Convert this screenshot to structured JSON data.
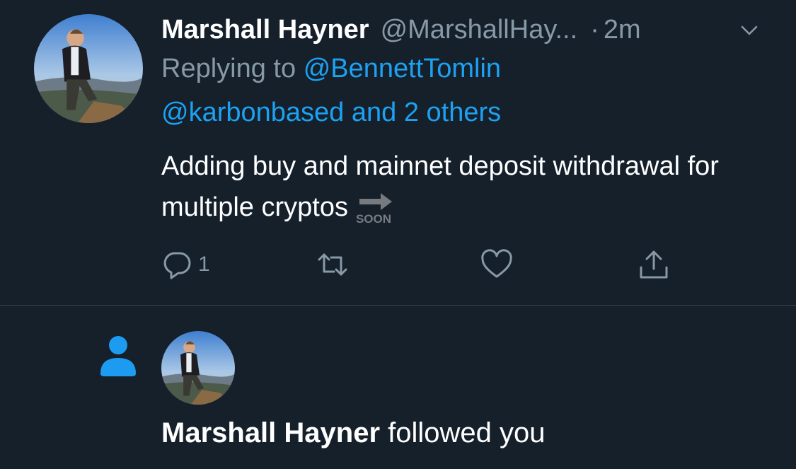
{
  "tweet": {
    "author_name": "Marshall Hayner",
    "author_handle": "@MarshallHay...",
    "separator": "·",
    "time": "2m",
    "replying_prefix": "Replying to",
    "replying_user": "@BennettTomlin",
    "replying_user_2": "@karbonbased",
    "replying_and_others": "and 2 others",
    "text": "Adding buy and mainnet deposit withdrawal for multiple cryptos",
    "emoji_text": "SOON",
    "reply_count": "1"
  },
  "notification": {
    "actor_name": "Marshall Hayner",
    "action_text": "followed you"
  },
  "colors": {
    "background": "#15202b",
    "muted": "#8899a6",
    "accent": "#1da1f2",
    "divider": "#38444d"
  },
  "icons": [
    "avatar-photo",
    "chevron-down-icon",
    "reply-icon",
    "retweet-icon",
    "like-icon",
    "share-icon",
    "soon-arrow-emoji",
    "person-icon"
  ]
}
